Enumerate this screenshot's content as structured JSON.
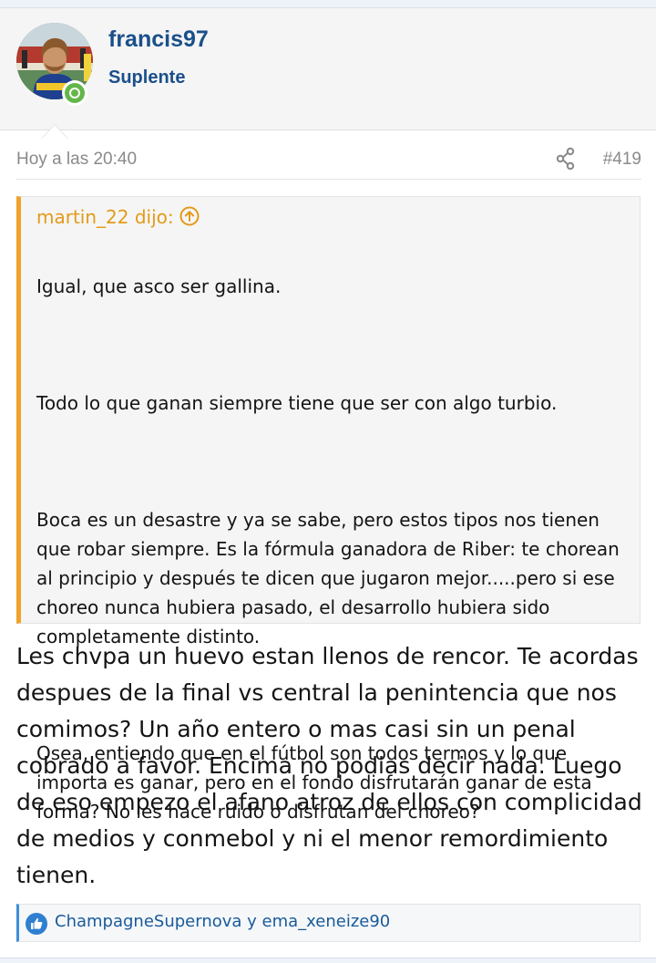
{
  "user": {
    "name": "francis97",
    "title": "Suplente",
    "status_color": "#63b649"
  },
  "post": {
    "timestamp": "Hoy a las 20:40",
    "number": "#419",
    "share_icon": "share-icon",
    "quote": {
      "author_line": "martin_22 dijo:",
      "jump_icon": "arrow-up-circle-icon",
      "paragraphs": [
        "Igual, que asco ser gallina.",
        "Todo lo que ganan siempre tiene que ser con algo turbio.",
        "Boca es un desastre y ya se sabe, pero estos tipos nos tienen que robar siempre. Es la fórmula ganadora de Riber: te chorean al principio y después te dicen que jugaron mejor.....pero si ese choreo nunca hubiera pasado, el desarrollo hubiera sido completamente distinto.",
        "Osea, entiendo que en el fútbol son todos termos y lo que importa es ganar, pero en el fondo disfrutarán ganar de esta forma? No les hace ruido o disfrutan del choreo?"
      ]
    },
    "body": "Les chvpa un huevo estan llenos de rencor. Te acordas despues de la final vs central la penintencia que nos comimos? Un año entero o mas casi sin un penal cobrado a favor. Encima no podias decir nada. Luego de eso empezo el afano atroz de ellos con complicidad de medios y conmebol y ni el menor remordimiento tienen.",
    "reactions": {
      "icon": "like-icon",
      "names": "ChampagneSupernova y ema_xeneize90"
    }
  },
  "colors": {
    "username": "#1a4f8a",
    "quote_accent": "#f0a22a",
    "quote_author": "#e39a17",
    "reaction_accent": "#3d8fd9"
  }
}
